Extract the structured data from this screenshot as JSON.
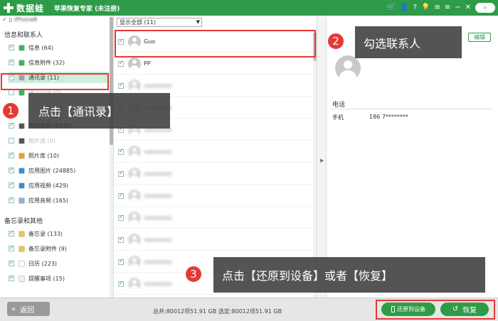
{
  "titlebar": {
    "brand": "数据蛙",
    "title": "苹果恢复专家 (未注册)",
    "icons": [
      "cart-icon",
      "user-icon",
      "help-icon",
      "bulb-icon",
      "wifi-icon",
      "menu-icon",
      "minimize-icon",
      "close-icon",
      "search-icon"
    ],
    "glyphs": {
      "cart": "🛒",
      "user": "👤",
      "help": "?",
      "bulb": "💡",
      "wifi": "≋",
      "menu": "≡",
      "minimize": "−",
      "close": "✕",
      "search": "⌕"
    }
  },
  "device": {
    "name": "iPhone8",
    "checked": true
  },
  "sidebar": {
    "groups": [
      {
        "title": "信息和联系人",
        "items": [
          {
            "label": "信息 (64)",
            "checked": true,
            "color": "#2ebd59"
          },
          {
            "label": "信息附件 (32)",
            "checked": true,
            "color": "#2ebd59"
          },
          {
            "label": "通讯录 (11)",
            "checked": true,
            "color": "#9aa3ad",
            "active": true
          },
          {
            "label": "通话记录 (0)",
            "checked": false,
            "color": "#2ebd59",
            "dim": true
          }
        ]
      },
      {
        "title": "媒体",
        "items": [
          {
            "label": "相机胶卷 (8338)",
            "checked": true,
            "color": "#555555"
          },
          {
            "label": "照片流 (0)",
            "checked": false,
            "color": "#555555",
            "dim": true
          },
          {
            "label": "照片库 (10)",
            "checked": true,
            "color": "#f2a01e"
          },
          {
            "label": "应用图片 (24885)",
            "checked": true,
            "color": "#2f8de4"
          },
          {
            "label": "应用视频 (429)",
            "checked": true,
            "color": "#2f8de4"
          },
          {
            "label": "应用音频 (165)",
            "checked": true,
            "color": "#8ab4e8"
          }
        ]
      },
      {
        "title": "备忘录和其他",
        "items": [
          {
            "label": "备忘录 (133)",
            "checked": true,
            "color": "#f6c343"
          },
          {
            "label": "备忘录附件 (9)",
            "checked": true,
            "color": "#f6c343"
          },
          {
            "label": "日历 (223)",
            "checked": true,
            "color": "#ffffff"
          },
          {
            "label": "提醒事项 (15)",
            "checked": true,
            "color": "#f2f2f2"
          }
        ]
      }
    ]
  },
  "filter": {
    "selected": "显示全部 (11)"
  },
  "contacts": [
    {
      "name": "Guo",
      "checked": true,
      "blurred": false
    },
    {
      "name": "PP",
      "checked": true,
      "blurred": false
    },
    {
      "name": "",
      "checked": true,
      "blurred": true
    },
    {
      "name": "",
      "checked": true,
      "blurred": true
    },
    {
      "name": "",
      "checked": true,
      "blurred": true
    },
    {
      "name": "",
      "checked": true,
      "blurred": true
    },
    {
      "name": "",
      "checked": true,
      "blurred": true
    },
    {
      "name": "",
      "checked": true,
      "blurred": true
    },
    {
      "name": "",
      "checked": true,
      "blurred": true
    },
    {
      "name": "",
      "checked": true,
      "blurred": true
    },
    {
      "name": "",
      "checked": true,
      "blurred": true
    },
    {
      "name": "",
      "checked": true,
      "blurred": true
    }
  ],
  "detail": {
    "edit_label": "编辑",
    "section": "电话",
    "phone_type": "手机",
    "phone_number": "186 7********"
  },
  "bottom": {
    "back_label": "返回",
    "back_glyph": "«",
    "totals": "总共:80012项51.91 GB 选定:80012项51.91 GB",
    "restore_device_label": "还原到设备",
    "restore_label": "恢复",
    "restore_glyph": "↺"
  },
  "annotations": [
    {
      "num": "1",
      "text": "点击【通讯录】"
    },
    {
      "num": "2",
      "text": "勾选联系人"
    },
    {
      "num": "3",
      "text": "点击【还原到设备】或者【恢复】"
    }
  ],
  "colors": {
    "brand": "#2e9b48",
    "highlight": "#e53935"
  }
}
